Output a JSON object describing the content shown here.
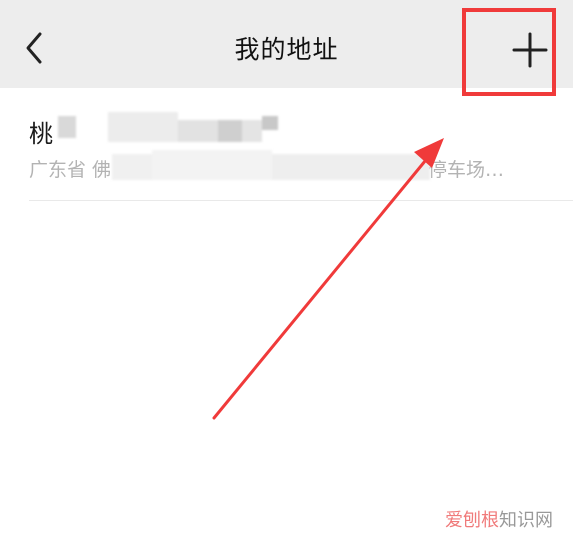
{
  "nav": {
    "title": "我的地址",
    "back_icon": "chevron-left-icon",
    "add_icon": "plus-icon"
  },
  "address": {
    "name_visible": "桃",
    "detail_visible": "广东省 佛",
    "detail_tail": "停车场…"
  },
  "annotation": {
    "highlight_color": "#f03a3a",
    "arrow_color": "#f03a3a"
  },
  "watermark": {
    "highlight": "爱刨根",
    "rest": "知识网"
  }
}
